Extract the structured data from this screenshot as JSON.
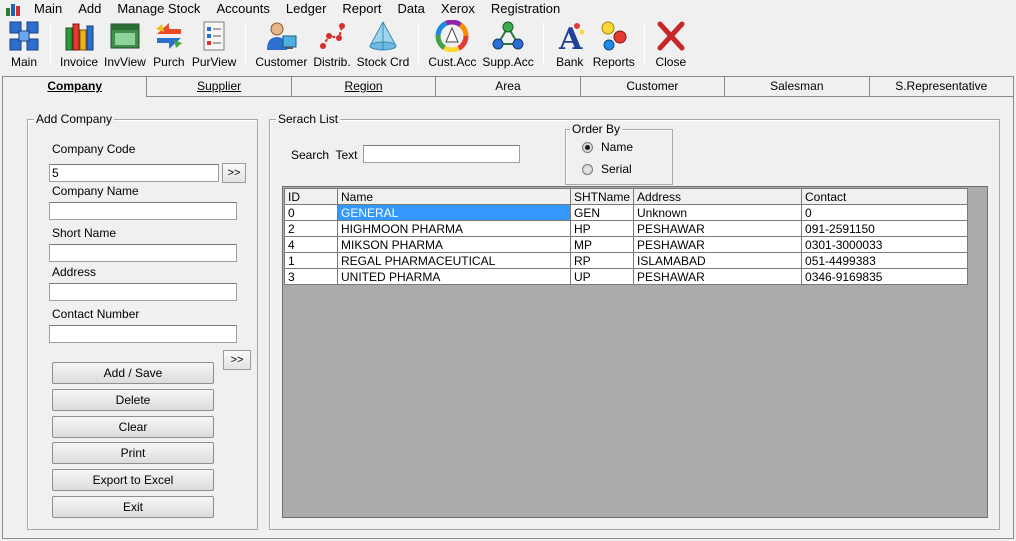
{
  "menu": {
    "items": [
      "Main",
      "Add",
      "Manage Stock",
      "Accounts",
      "Ledger",
      "Report",
      "Data",
      "Xerox",
      "Registration"
    ]
  },
  "toolbar": {
    "buttons": [
      {
        "label": "Main",
        "icon": "main-grid-icon"
      },
      {
        "label": "Invoice",
        "icon": "invoice-books-icon"
      },
      {
        "label": "InvView",
        "icon": "invoice-view-window-icon"
      },
      {
        "label": "Purch",
        "icon": "purchase-arrows-icon"
      },
      {
        "label": "PurView",
        "icon": "purchase-checklist-icon"
      },
      {
        "label": "Customer",
        "icon": "customer-person-icon"
      },
      {
        "label": "Distrib.",
        "icon": "distributor-nodes-icon"
      },
      {
        "label": "Stock Crd",
        "icon": "stock-cone-icon"
      },
      {
        "label": "Cust.Acc",
        "icon": "customer-account-color-wheel-icon"
      },
      {
        "label": "Supp.Acc",
        "icon": "supplier-account-network-icon"
      },
      {
        "label": "Bank",
        "icon": "bank-letter-a-icon"
      },
      {
        "label": "Reports",
        "icon": "reports-dots-icon"
      },
      {
        "label": "Close",
        "icon": "close-x-icon"
      }
    ]
  },
  "tabs": [
    {
      "label": "Company",
      "underline": "C",
      "rest": "ompany",
      "active": true
    },
    {
      "label": "Supplier",
      "underline": "S",
      "rest": "upplier",
      "active": false
    },
    {
      "label": "Region",
      "underline": "R",
      "rest": "egion",
      "active": false
    },
    {
      "label": "Area",
      "underline": "",
      "rest": "Area",
      "active": false
    },
    {
      "label": "Customer",
      "underline": "",
      "rest": "Customer",
      "active": false
    },
    {
      "label": "Salesman",
      "underline": "",
      "rest": "Salesman",
      "active": false
    },
    {
      "label": "S.Representative",
      "underline": "",
      "rest": "S.Representative",
      "active": false
    }
  ],
  "add_company": {
    "title": "Add Company",
    "company_code_label": "Company Code",
    "company_code_value": "5",
    "company_name_label": "Company Name",
    "company_name_value": "",
    "short_name_label": "Short Name",
    "short_name_value": "",
    "address_label": "Address",
    "address_value": "",
    "contact_label": "Contact Number",
    "contact_value": "",
    "expand_label": ">>",
    "buttons": {
      "add_save": "Add / Save",
      "delete": "Delete",
      "clear": "Clear",
      "print": "Print",
      "export": "Export to Excel",
      "exit": "Exit"
    }
  },
  "search_list": {
    "title": "Serach List",
    "search_label": "Search  Text",
    "search_value": "",
    "order_by": {
      "title": "Order By",
      "options": [
        {
          "label": "Name",
          "checked": true
        },
        {
          "label": "Serial",
          "checked": false
        }
      ]
    },
    "columns": [
      "ID",
      "Name",
      "SHTName",
      "Address",
      "Contact"
    ],
    "rows": [
      [
        "0",
        "GENERAL",
        "GEN",
        "Unknown",
        "0"
      ],
      [
        "2",
        "HIGHMOON PHARMA",
        "HP",
        "PESHAWAR",
        "091-2591150"
      ],
      [
        "4",
        "MIKSON PHARMA",
        "MP",
        "PESHAWAR",
        "0301-3000033"
      ],
      [
        "1",
        "REGAL PHARMACEUTICAL",
        "RP",
        "ISLAMABAD",
        "051-4499383"
      ],
      [
        "3",
        "UNITED PHARMA",
        "UP",
        "PESHAWAR",
        "0346-9169835"
      ]
    ],
    "selected_row": 0
  },
  "colors": {
    "selection": "#3399ff",
    "window_bg": "#f0f0f0"
  }
}
